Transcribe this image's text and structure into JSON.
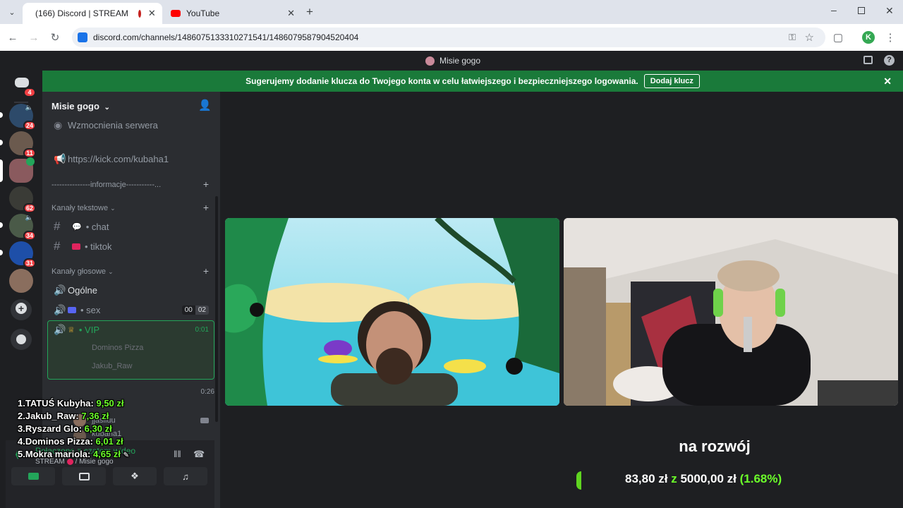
{
  "browser": {
    "tabs": [
      {
        "title": "(166) Discord | STREAM",
        "active": true
      },
      {
        "title": "YouTube",
        "active": false
      }
    ],
    "url": "discord.com/channels/1486075133310271541/1486079587904520404",
    "profile_initial": "K"
  },
  "discord": {
    "window_title": "Misie gogo",
    "notice": {
      "text": "Sugerujemy dodanie klucza do Twojego konta w celu łatwiejszego i bezpieczniejszego logowania.",
      "button": "Dodaj klucz"
    },
    "guild_badges": [
      "4",
      "24",
      "11",
      "62",
      "34",
      "31"
    ],
    "server_name": "Misie gogo",
    "channels_top": [
      {
        "label": "Wzmocnienia serwera"
      },
      {
        "label": "https://kick.com/kubaha1"
      }
    ],
    "info_divider": "---------------informacje-----------...",
    "text_category": "Kanały tekstowe",
    "text_channels": [
      {
        "label": "• chat"
      },
      {
        "label": "• tiktok"
      }
    ],
    "voice_category": "Kanały głosowe",
    "voice_channels": [
      {
        "label": "Ogólne"
      },
      {
        "label": "• sex",
        "count_a": "00",
        "count_b": "02"
      },
      {
        "label": "• VIP",
        "timer": "0:01"
      }
    ],
    "vip_members": [
      "Dominos Pizza",
      "Jakub_Raw"
    ],
    "second_timer": "0:26",
    "more_members": [
      "jjasliuu",
      "kubaha1"
    ],
    "voice_panel": {
      "status": "Połączono z czatem wideo",
      "location": "STREAM",
      "location_suffix": "/ Misie gogo"
    }
  },
  "leaderboard": [
    {
      "rank": "1.",
      "name": "TATUŚ Kubyha:",
      "amount": "9,50 zł"
    },
    {
      "rank": "2.",
      "name": "Jakub_Raw:",
      "amount": "7,36 zł"
    },
    {
      "rank": "3.",
      "name": "Ryszard Glo:",
      "amount": "6,30 zł"
    },
    {
      "rank": "4.",
      "name": "Dominos Pizza:",
      "amount": "6,01 zł"
    },
    {
      "rank": "5.",
      "name": "Mokra mariola:",
      "amount": "4,65 zł"
    }
  ],
  "goal": {
    "title": "na rozwój",
    "current": "83,80 zł",
    "joiner": "z",
    "target": "5000,00 zł",
    "percent": "(1.68%)",
    "progress_fraction": 0.0168
  },
  "colors": {
    "notice_green": "#1a7a3a",
    "accent_green": "#6cff2a",
    "badge_red": "#f23f43"
  }
}
